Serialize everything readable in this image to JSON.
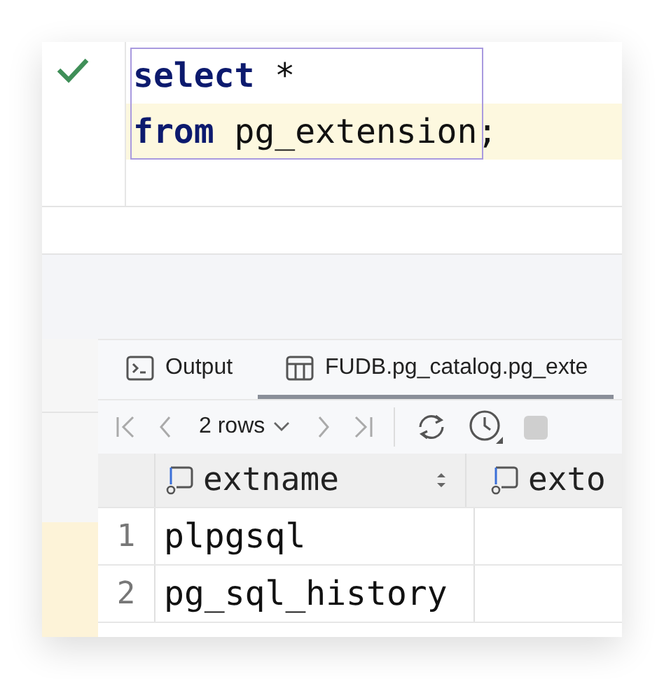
{
  "editor": {
    "succeeded": true,
    "lines": [
      {
        "current": false,
        "outlined": true,
        "tokens": [
          {
            "text": "select",
            "kind": "keyword"
          },
          {
            "text": " *",
            "kind": "plain"
          }
        ]
      },
      {
        "current": true,
        "outlined": true,
        "tokens": [
          {
            "text": "from",
            "kind": "keyword"
          },
          {
            "text": " pg_extension",
            "kind": "plain"
          }
        ],
        "trailing": ";"
      }
    ]
  },
  "results": {
    "tabs": [
      {
        "label": "Output",
        "kind": "console",
        "selected": false
      },
      {
        "label": "FUDB.pg_catalog.pg_exte",
        "kind": "table",
        "selected": true
      }
    ],
    "toolbar": {
      "rows_label": "2 rows"
    },
    "columns": [
      {
        "label": "extname",
        "sortable": true
      },
      {
        "label": "exto",
        "sortable": false
      }
    ],
    "rows": [
      {
        "number": "1",
        "cells": [
          "plpgsql"
        ]
      },
      {
        "number": "2",
        "cells": [
          "pg_sql_history"
        ]
      }
    ]
  }
}
